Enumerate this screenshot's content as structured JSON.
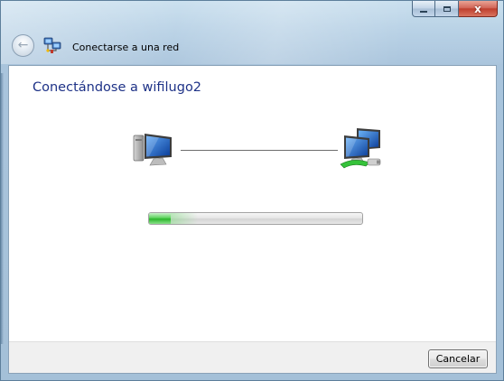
{
  "window": {
    "title": "Conectarse a una red",
    "icons": {
      "back": "back-arrow-icon",
      "network": "network-wizard-icon",
      "minimize": "minimize-icon",
      "maximize": "maximize-icon",
      "close": "close-icon"
    },
    "caption_close_glyph": "x"
  },
  "nav": {
    "back_glyph": "←"
  },
  "main": {
    "heading": "Conectándose a wifilugo2",
    "progress_percent": 10,
    "devices": [
      "computer-icon",
      "network-computers-icon"
    ]
  },
  "footer": {
    "cancel_label": "Cancelar"
  },
  "colors": {
    "heading": "#1e3287",
    "progress_fill": "#2bb52b",
    "frame": "#b9d2e6"
  }
}
